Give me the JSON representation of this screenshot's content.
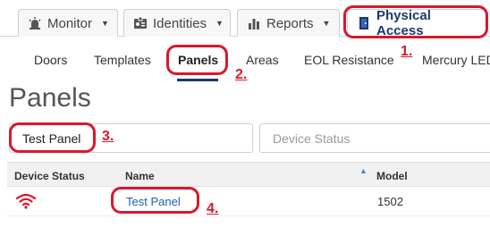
{
  "topnav": {
    "tabs": [
      {
        "label": "Monitor",
        "icon": "monitor-alarm-icon"
      },
      {
        "label": "Identities",
        "icon": "id-card-icon"
      },
      {
        "label": "Reports",
        "icon": "bar-chart-icon"
      },
      {
        "label": "Physical Access",
        "icon": "door-icon",
        "active": true
      }
    ]
  },
  "subnav": {
    "items": [
      "Doors",
      "Templates",
      "Panels",
      "Areas",
      "EOL Resistance",
      "Mercury LED"
    ],
    "active": "Panels"
  },
  "page": {
    "title": "Panels"
  },
  "filters": {
    "name_value": "Test Panel",
    "status_placeholder": "Device Status"
  },
  "table": {
    "columns": [
      "Device Status",
      "Name",
      "Model"
    ],
    "sort_column": "Name",
    "sort_direction": "ascending",
    "rows": [
      {
        "status_icon": "wifi-signal-icon",
        "name": "Test Panel",
        "model": "1502"
      }
    ]
  },
  "annotations": [
    "1.",
    "2.",
    "3.",
    "4."
  ],
  "colors": {
    "annotation": "#d8192b",
    "accent": "#1a3a6e",
    "link": "#1f5fa8",
    "status_icon": "#d8192b"
  }
}
